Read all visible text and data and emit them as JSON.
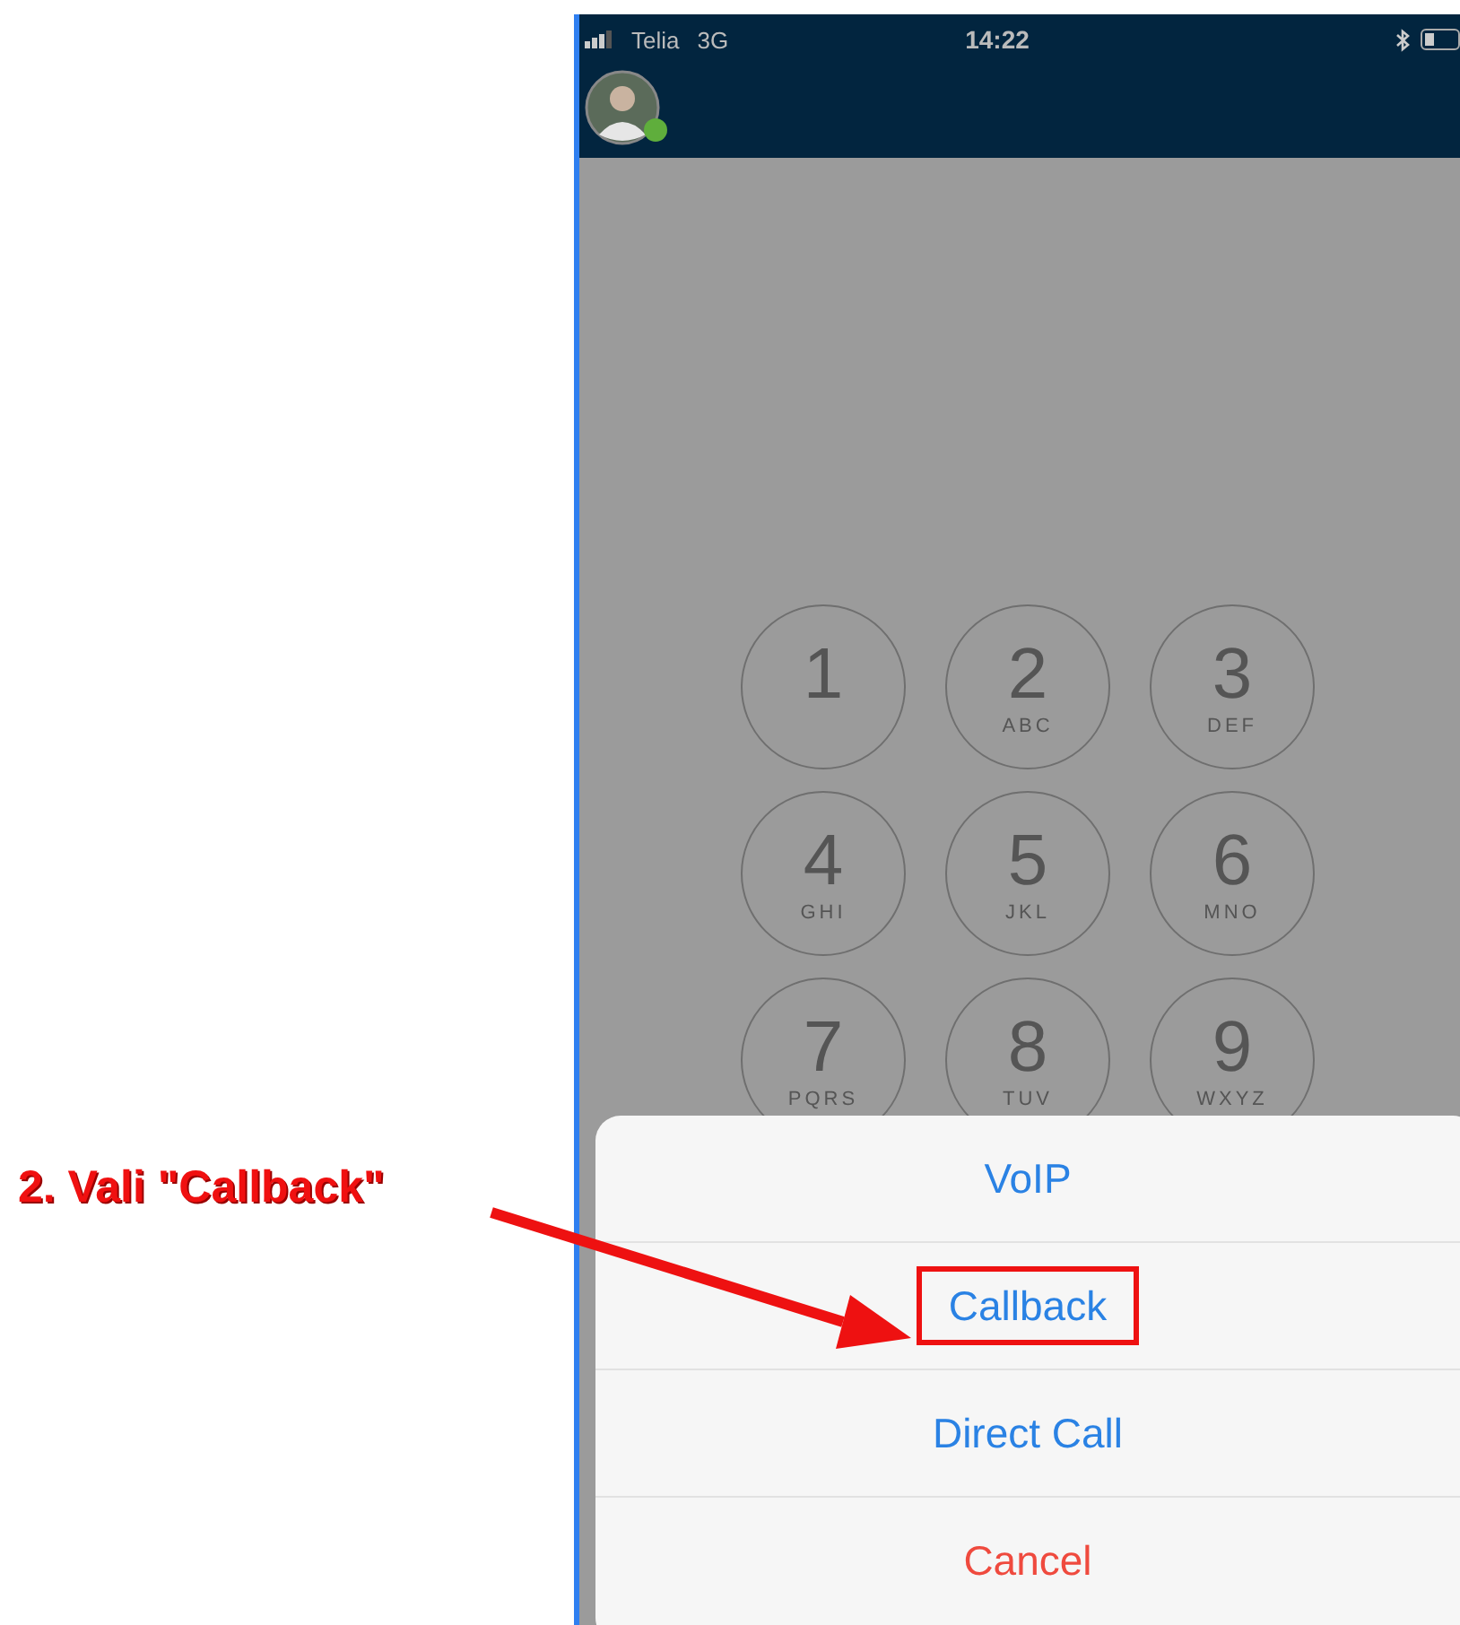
{
  "annotation": {
    "text": "2. Vali \"Callback\""
  },
  "status_bar": {
    "carrier": "Telia",
    "network": "3G",
    "time": "14:22"
  },
  "profile": {
    "online": true
  },
  "keypad": [
    {
      "digit": "1"
    },
    {
      "digit": "2",
      "letters": "ABC"
    },
    {
      "digit": "3",
      "letters": "DEF"
    },
    {
      "digit": "4",
      "letters": "GHI"
    },
    {
      "digit": "5",
      "letters": "JKL"
    },
    {
      "digit": "6",
      "letters": "MNO"
    },
    {
      "digit": "7",
      "letters": "PQRS"
    },
    {
      "digit": "8",
      "letters": "TUV"
    },
    {
      "digit": "9",
      "letters": "WXYZ"
    }
  ],
  "action_sheet": [
    {
      "label": "VoIP",
      "kind": "action",
      "highlighted": false
    },
    {
      "label": "Callback",
      "kind": "action",
      "highlighted": true
    },
    {
      "label": "Direct Call",
      "kind": "action",
      "highlighted": false
    },
    {
      "label": "Cancel",
      "kind": "cancel",
      "highlighted": false
    }
  ]
}
